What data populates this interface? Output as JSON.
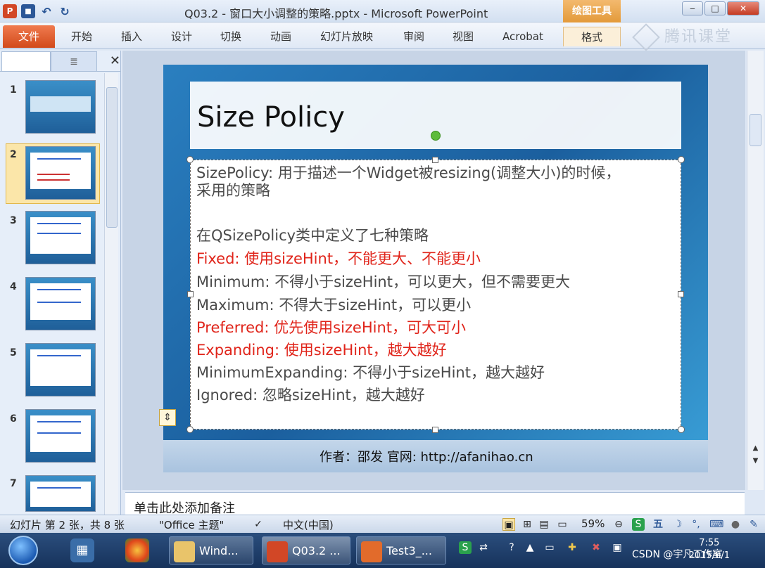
{
  "titlebar": {
    "title": "Q03.2 - 窗口大小调整的策略.pptx - Microsoft PowerPoint",
    "tool_tab": "绘图工具",
    "logo_text": "P",
    "minimize": "‒",
    "maximize": "□",
    "close": "✕"
  },
  "ribbon": {
    "tabs": [
      "文件",
      "开始",
      "插入",
      "设计",
      "切换",
      "动画",
      "幻灯片放映",
      "审阅",
      "视图",
      "Acrobat",
      "格式"
    ],
    "watermark": "腾讯课堂"
  },
  "thumbnails": {
    "numbers": [
      "1",
      "2",
      "3",
      "4",
      "5",
      "6",
      "7"
    ]
  },
  "slide": {
    "title": "Size Policy",
    "lines": [
      {
        "text": "SizePolicy: 用于描述一个Widget被resizing(调整大小)的时候，",
        "color": "gray"
      },
      {
        "text": "采用的策略",
        "color": "gray"
      },
      {
        "text": "在QSizePolicy类中定义了七种策略",
        "color": "gray"
      },
      {
        "text": "Fixed: 使用sizeHint，不能更大、不能更小",
        "color": "red"
      },
      {
        "text": "Minimum: 不得小于sizeHint，可以更大，但不需要更大",
        "color": "gray"
      },
      {
        "text": "Maximum: 不得大于sizeHint，可以更小",
        "color": "gray"
      },
      {
        "text": "Preferred: 优先使用sizeHint，可大可小",
        "color": "red"
      },
      {
        "text": "Expanding: 使用sizeHint，越大越好",
        "color": "red"
      },
      {
        "text": "MinimumExpanding: 不得小于sizeHint，越大越好",
        "color": "gray"
      },
      {
        "text": "Ignored: 忽略sizeHint，越大越好",
        "color": "gray"
      }
    ],
    "footer": "作者：邵发 官网: http://afanihao.cn"
  },
  "notes": {
    "placeholder": "单击此处添加备注"
  },
  "statusbar": {
    "slide_info": "幻灯片 第 2 张，共 8 张",
    "theme": "\"Office 主题\"",
    "language": "中文(中国)",
    "zoom": "59%"
  },
  "taskbar": {
    "tasks": [
      {
        "label": "Wind..."
      },
      {
        "label": "Q03.2 ..."
      },
      {
        "label": "Test3_..."
      }
    ],
    "clock_time": "7:55",
    "clock_date": "2015/6/1",
    "csdn": "CSDN @宇凡工作室"
  }
}
